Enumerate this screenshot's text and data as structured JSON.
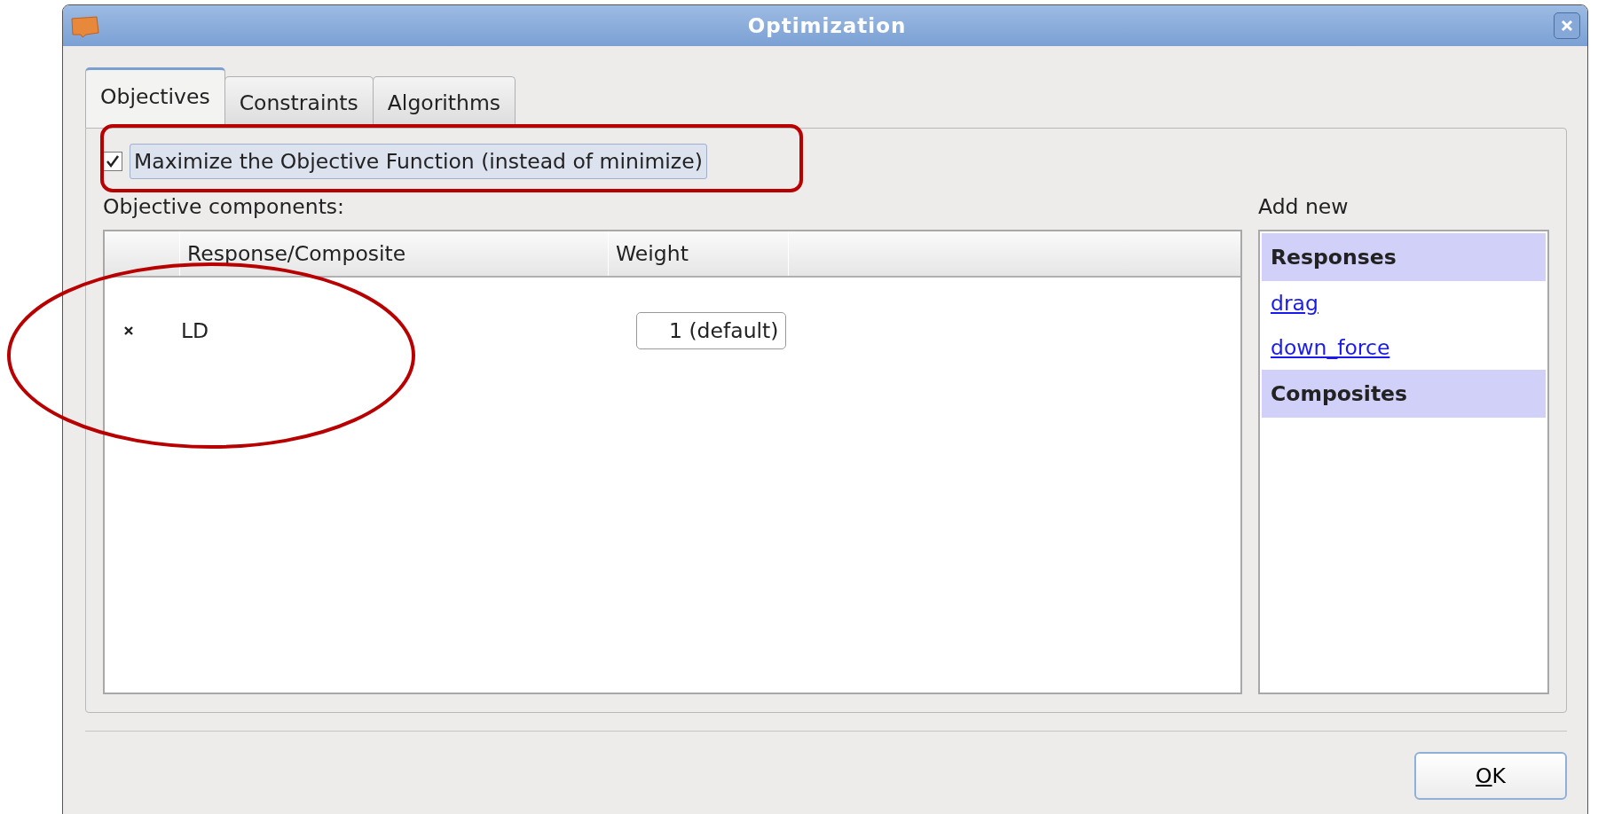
{
  "window": {
    "title": "Optimization"
  },
  "tabs": [
    {
      "label": "Objectives",
      "selected": true
    },
    {
      "label": "Constraints",
      "selected": false
    },
    {
      "label": "Algorithms",
      "selected": false
    }
  ],
  "maximize": {
    "label": "Maximize the Objective Function (instead of minimize)",
    "checked": true
  },
  "components": {
    "label": "Objective components:",
    "columns": [
      "Response/Composite",
      "Weight"
    ],
    "rows": [
      {
        "name": "LD",
        "weight": "1 (default)"
      }
    ]
  },
  "add_new": {
    "label": "Add new",
    "items": [
      {
        "kind": "header",
        "text": "Responses"
      },
      {
        "kind": "link",
        "text": "drag"
      },
      {
        "kind": "link",
        "text": "down_force"
      },
      {
        "kind": "header",
        "text": "Composites"
      }
    ]
  },
  "buttons": [
    "OK"
  ],
  "annotations": [
    {
      "kind": "rounded-box"
    },
    {
      "kind": "ellipse"
    }
  ]
}
